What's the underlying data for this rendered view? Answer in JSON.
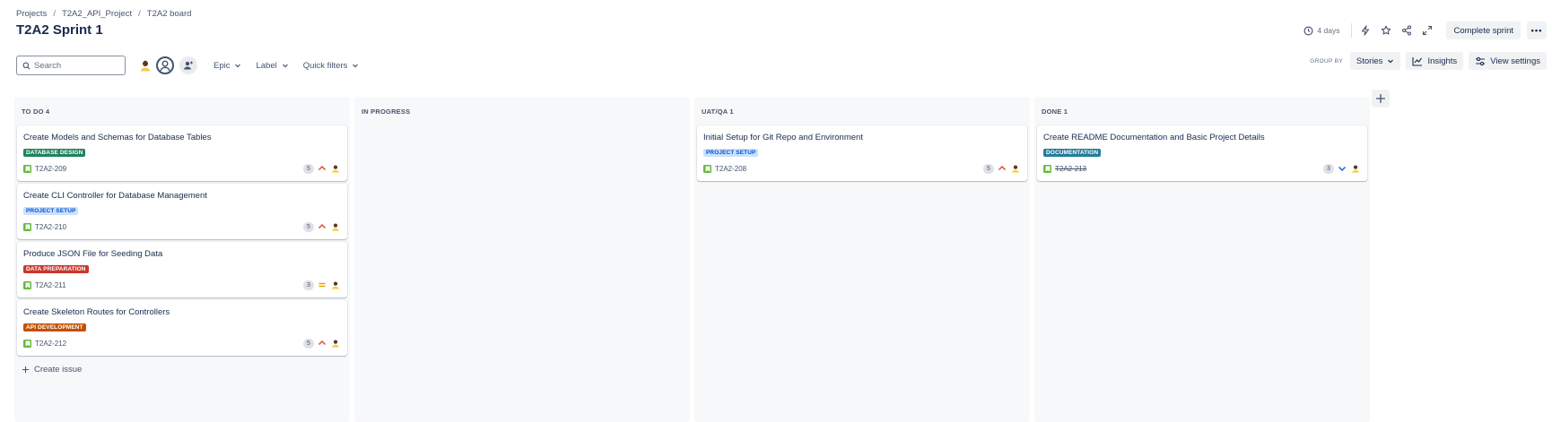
{
  "breadcrumb": [
    "Projects",
    "T2A2_API_Project",
    "T2A2 board"
  ],
  "title": "T2A2 Sprint 1",
  "header": {
    "days_left": "4 days",
    "complete_sprint": "Complete sprint",
    "more": "•••"
  },
  "toolbar": {
    "search_placeholder": "Search",
    "filters": [
      "Epic",
      "Label",
      "Quick filters"
    ],
    "group_by_label": "GROUP BY",
    "group_by_value": "Stories",
    "insights": "Insights",
    "view_settings": "View settings"
  },
  "colors": {
    "story_green": "#63ba3c",
    "priority_high": "#e2483d",
    "priority_medium": "#e5a400",
    "priority_low": "#0c66e4"
  },
  "columns": [
    {
      "title": "TO DO 4",
      "create_issue": "Create issue",
      "cards": [
        {
          "title": "Create Models and Schemas for Database Tables",
          "label": "DATABASE DESIGN",
          "label_bg": "#1f845a",
          "label_fg": "#ffffff",
          "key": "T2A2-209",
          "points": "5",
          "priority": "high",
          "done": false
        },
        {
          "title": "Create CLI Controller for Database Management",
          "label": "PROJECT SETUP",
          "label_bg": "#cce0ff",
          "label_fg": "#0055cc",
          "key": "T2A2-210",
          "points": "5",
          "priority": "high",
          "done": false
        },
        {
          "title": "Produce JSON File for Seeding Data",
          "label": "DATA PREPARATION",
          "label_bg": "#c9372c",
          "label_fg": "#ffffff",
          "key": "T2A2-211",
          "points": "3",
          "priority": "medium",
          "done": false
        },
        {
          "title": "Create Skeleton Routes for Controllers",
          "label": "API DEVELOPMENT",
          "label_bg": "#c25100",
          "label_fg": "#ffffff",
          "key": "T2A2-212",
          "points": "5",
          "priority": "high",
          "done": false
        }
      ]
    },
    {
      "title": "IN PROGRESS",
      "cards": []
    },
    {
      "title": "UAT/QA 1",
      "cards": [
        {
          "title": "Initial Setup for Git Repo and Environment",
          "label": "PROJECT SETUP",
          "label_bg": "#cce0ff",
          "label_fg": "#0055cc",
          "key": "T2A2-208",
          "points": "5",
          "priority": "high",
          "done": false
        }
      ]
    },
    {
      "title": "DONE 1",
      "cards": [
        {
          "title": "Create README Documentation and Basic Project Details",
          "label": "DOCUMENTATION",
          "label_bg": "#227d9b",
          "label_fg": "#ffffff",
          "key": "T2A2-213",
          "points": "3",
          "priority": "low",
          "done": true
        }
      ]
    }
  ]
}
